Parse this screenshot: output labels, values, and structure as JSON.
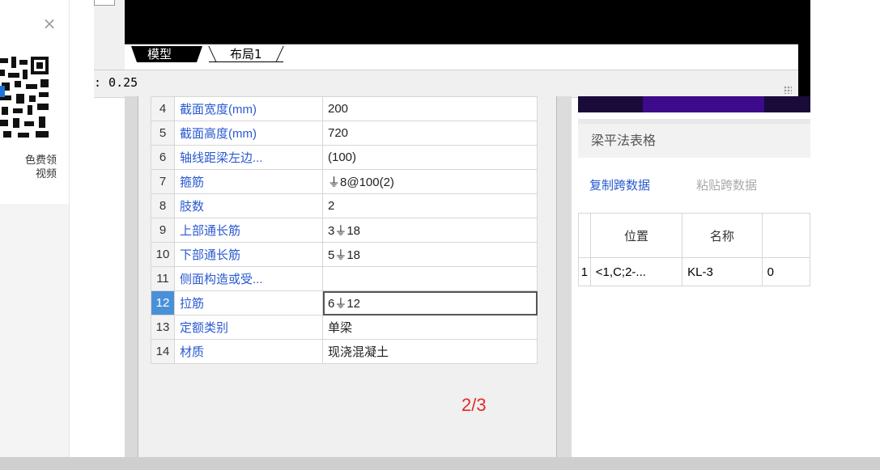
{
  "promo": {
    "close_glyph": "×",
    "text_line1": "色费领",
    "text_line2": "视频"
  },
  "tabs": {
    "model": "模型",
    "layout": "布局1"
  },
  "status": {
    "value": ": 0.25"
  },
  "properties": [
    {
      "num": "4",
      "name": "截面宽度(mm)",
      "value": "200"
    },
    {
      "num": "5",
      "name": "截面高度(mm)",
      "value": "720"
    },
    {
      "num": "6",
      "name": "轴线距梁左边...",
      "value": "(100)"
    },
    {
      "num": "7",
      "name": "箍筋",
      "value": "⏚8@100(2)"
    },
    {
      "num": "8",
      "name": "肢数",
      "value": "2"
    },
    {
      "num": "9",
      "name": "上部通长筋",
      "value": "3⏚18"
    },
    {
      "num": "10",
      "name": "下部通长筋",
      "value": "5⏚18"
    },
    {
      "num": "11",
      "name": "侧面构造或受...",
      "value": ""
    },
    {
      "num": "12",
      "name": "拉筋",
      "value": "6⏚12"
    },
    {
      "num": "13",
      "name": "定额类别",
      "value": "单梁"
    },
    {
      "num": "14",
      "name": "材质",
      "value": "现浇混凝土"
    }
  ],
  "page_indicator": "2/3",
  "span_panel": {
    "title": "梁平法表格",
    "copy_label": "复制跨数据",
    "paste_label": "粘贴跨数据",
    "headers": [
      "位置",
      "名称",
      ""
    ],
    "rows": [
      {
        "idx": "1",
        "position": "<1,C;2-...",
        "name": "KL-3",
        "third": "0"
      }
    ]
  },
  "colors": {
    "accent_blue": "#2a5ad0",
    "selected_row": "#4a90d9",
    "page_indicator": "#e32b2b"
  }
}
